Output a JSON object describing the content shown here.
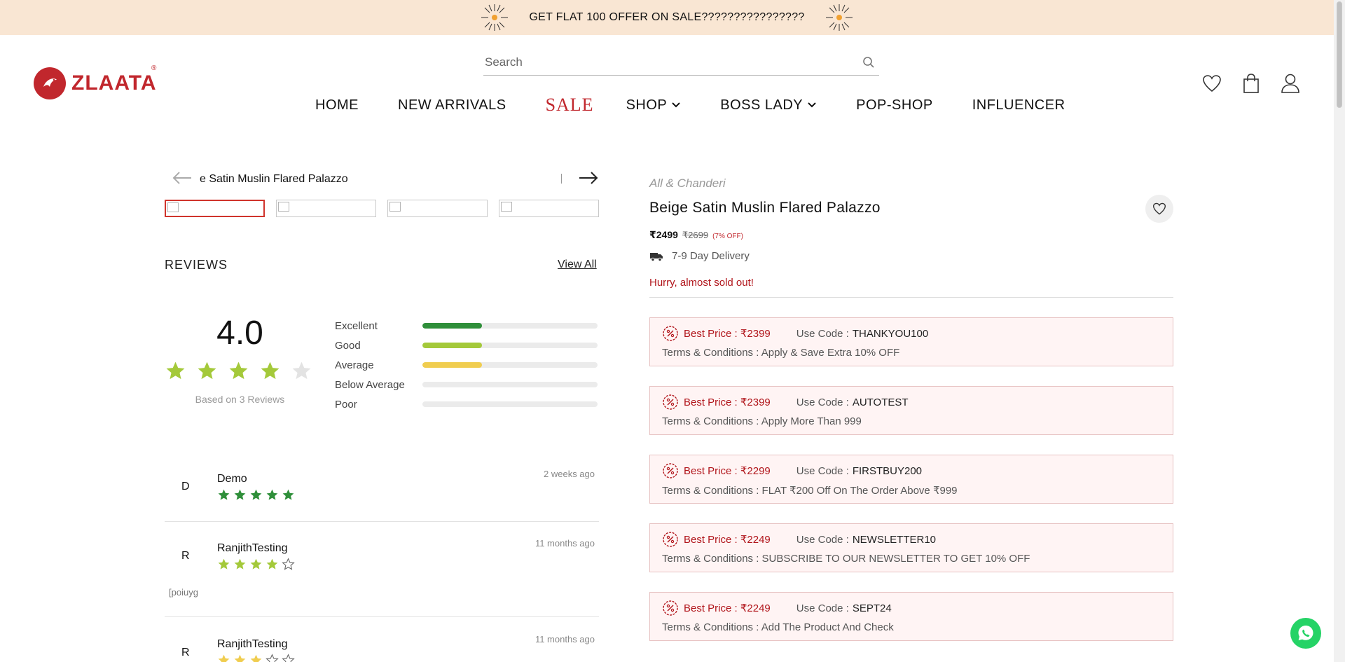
{
  "announcement": {
    "text": "GET FLAT 100 OFFER ON SALE????????????????"
  },
  "brand": {
    "name": "ZLAATA",
    "registered": "®"
  },
  "search": {
    "placeholder": "Search"
  },
  "nav": {
    "home": "HOME",
    "new_arrivals": "NEW ARRIVALS",
    "sale": "SALE",
    "shop": "SHOP",
    "boss_lady": "BOSS LADY",
    "pop_shop": "POP-SHOP",
    "influencer": "INFLUENCER"
  },
  "header_icons": [
    "heart-icon",
    "shopping-bag-icon",
    "user-icon"
  ],
  "gallery": {
    "title": "e Satin Muslin Flared Palazzo",
    "thumbnail_count": 4,
    "active_thumbnail": 1
  },
  "reviews": {
    "title": "REVIEWS",
    "view_all": "View All",
    "average": "4.0",
    "average_stars": 4,
    "based_on": "Based on 3 Reviews",
    "breakdown": [
      {
        "label": "Excellent",
        "fraction": 0.34,
        "color": "#2f8f3a"
      },
      {
        "label": "Good",
        "fraction": 0.34,
        "color": "#a4c93a"
      },
      {
        "label": "Average",
        "fraction": 0.34,
        "color": "#f0cd4f"
      },
      {
        "label": "Below Average",
        "fraction": 0,
        "color": "#e9a23b"
      },
      {
        "label": "Poor",
        "fraction": 0,
        "color": "#d9534f"
      }
    ],
    "items": [
      {
        "initial": "D",
        "name": "Demo",
        "when": "2 weeks ago",
        "stars": 5,
        "star_color": "#2f8f3a",
        "body": ""
      },
      {
        "initial": "R",
        "name": "RanjithTesting",
        "when": "11 months ago",
        "stars": 4,
        "star_color": "#a4c93a",
        "body": "[poiuyg"
      },
      {
        "initial": "R",
        "name": "RanjithTesting",
        "when": "11 months ago",
        "stars": 3,
        "star_color": "#f0cd4f",
        "body": ""
      }
    ]
  },
  "product": {
    "collection": "All & Chanderi",
    "title": "Beige Satin Muslin Flared Palazzo",
    "price": "₹2499",
    "mrp": "₹2699",
    "discount": "(7% OFF)",
    "delivery": "7-9 Day Delivery",
    "stock_note": "Hurry, almost sold out!"
  },
  "offers": [
    {
      "best_price": "Best Price : ₹2399",
      "use_code_label": "Use Code :",
      "code": "THANKYOU100",
      "terms": "Terms & Conditions : Apply & Save Extra 10% OFF"
    },
    {
      "best_price": "Best Price : ₹2399",
      "use_code_label": "Use Code :",
      "code": "AUTOTEST",
      "terms": "Terms & Conditions : Apply More Than 999"
    },
    {
      "best_price": "Best Price : ₹2299",
      "use_code_label": "Use Code :",
      "code": "FIRSTBUY200",
      "terms": "Terms & Conditions : FLAT ₹200 Off On The Order Above ₹999"
    },
    {
      "best_price": "Best Price : ₹2249",
      "use_code_label": "Use Code :",
      "code": "NEWSLETTER10",
      "terms": "Terms & Conditions : SUBSCRIBE TO OUR NEWSLETTER TO GET 10% OFF"
    },
    {
      "best_price": "Best Price : ₹2249",
      "use_code_label": "Use Code :",
      "code": "SEPT24",
      "terms": "Terms & Conditions : Add The Product And Check"
    }
  ],
  "colors": {
    "brand_red": "#c1272d",
    "announce_bg": "#f9e6d3",
    "offer_bg": "#fff4f4",
    "whatsapp": "#25d366",
    "star_empty": "#e3e3e3"
  }
}
